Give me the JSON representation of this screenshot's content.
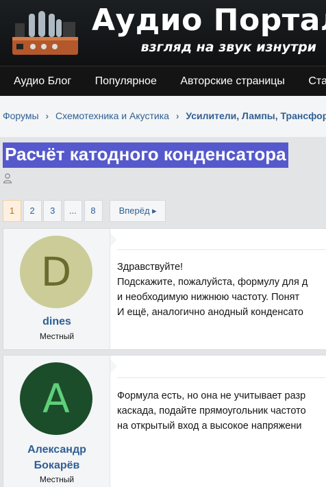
{
  "header": {
    "title": "Аудио Портал",
    "subtitle": "взгляд на звук изнутри",
    "logo_icon": "tube-amplifier-icon"
  },
  "nav": {
    "items": [
      "Аудио Блог",
      "Популярное",
      "Авторские страницы",
      "Ста"
    ]
  },
  "breadcrumb": {
    "items": [
      "Форумы",
      "Схемотехника и Акустика",
      "Усилители, Лампы, Трансформ"
    ],
    "separator": "›"
  },
  "thread": {
    "title": "Расчёт катодного конденсатора",
    "author_icon": "user-icon"
  },
  "pagination": {
    "pages": [
      "1",
      "2",
      "3",
      "...",
      "8"
    ],
    "active": "1",
    "next_label": "Вперёд ▸"
  },
  "posts": [
    {
      "avatar_letter": "D",
      "username": "dines",
      "role": "Местный",
      "lines": [
        "Здравствуйте!",
        "Подскажите, пожалуйста, формулу для д",
        "и необходимую нижнюю частоту. Понят",
        "И ещё, аналогично анодный конденсато"
      ]
    },
    {
      "avatar_letter": "A",
      "username_line1": "Александр",
      "username_line2": "Бокарёв",
      "role": "Местный",
      "lines": [
        "Формула есть, но она не учитывает разр",
        "каскада, подайте прямоугольник частото",
        "на открытый вход а высокое напряжени"
      ]
    }
  ],
  "colors": {
    "link": "#2f5f94",
    "title_highlight": "#5559cc",
    "nav_bg": "#141414"
  }
}
